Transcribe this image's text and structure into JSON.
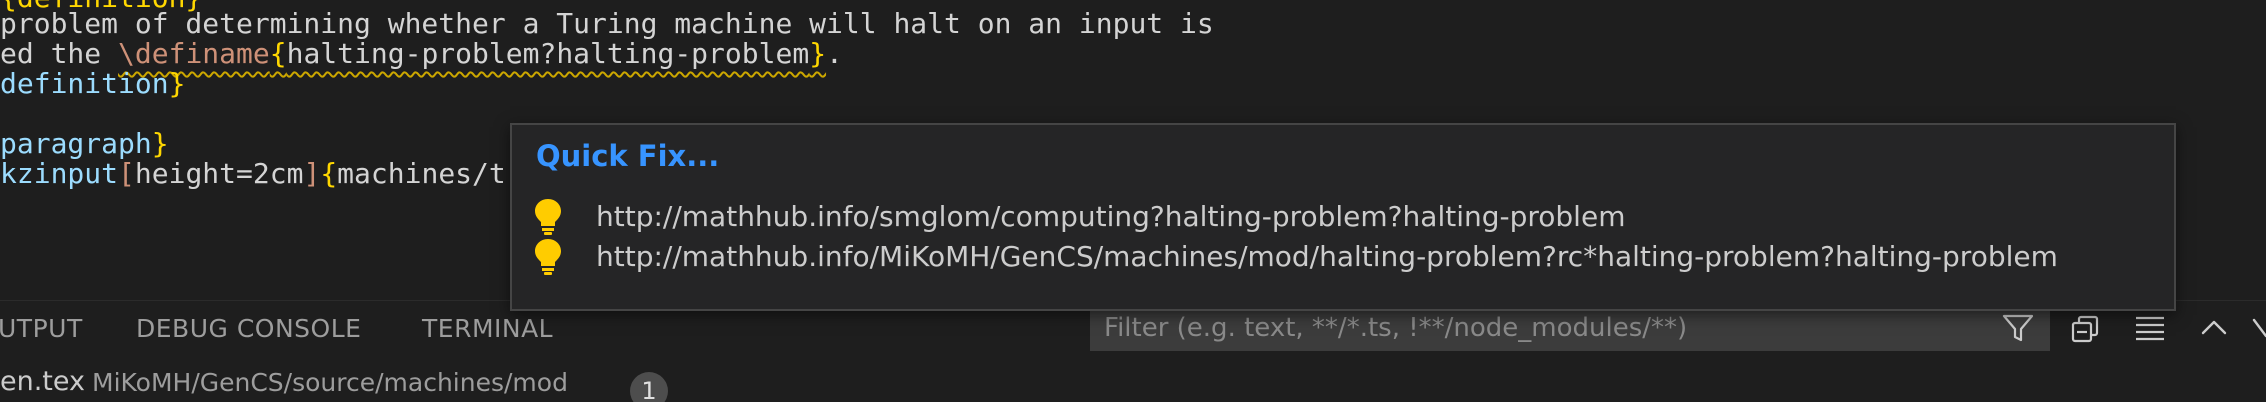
{
  "editor": {
    "line0": {
      "fragment": "{definition}"
    },
    "line1": {
      "text": "problem of determining whether a Turing machine will halt on an input is"
    },
    "line2": {
      "prefix": "ed the ",
      "macro": "\\definame",
      "brace_open": "{",
      "arg": "halting-problem?halting-problem",
      "brace_close": "}",
      "tail": "."
    },
    "line3": {
      "text": "definition",
      "brace": "}"
    },
    "line5": {
      "text": "paragraph",
      "brace": "}"
    },
    "line6": {
      "cmd": "kzinput",
      "opt_open": "[",
      "opt": "height=2cm",
      "opt_close": "]",
      "brace_open": "{",
      "arg": "machines/t"
    }
  },
  "quickfix": {
    "title": "Quick Fix...",
    "items": [
      {
        "label": "http://mathhub.info/smglom/computing?halting-problem?halting-problem",
        "icon": "lightbulb-icon"
      },
      {
        "label": "http://mathhub.info/MiKoMH/GenCS/machines/mod/halting-problem?rc*halting-problem?halting-problem",
        "icon": "lightbulb-icon"
      }
    ]
  },
  "panel": {
    "tabs": [
      "UTPUT",
      "DEBUG CONSOLE",
      "TERMINAL"
    ],
    "filter_placeholder": "Filter (e.g. text, **/*.ts, !**/node_modules/**)",
    "icons": [
      "filter-icon",
      "collapse-all-icon",
      "list-view-icon",
      "chevron-up-icon"
    ],
    "problem_file": {
      "name": "en.tex",
      "path": "MiKoMH/GenCS/source/machines/mod",
      "count": "1"
    }
  },
  "colors": {
    "accent": "#3794ff",
    "bulb": "#ffcc00",
    "background": "#1e1e1e",
    "popup": "#252526"
  }
}
